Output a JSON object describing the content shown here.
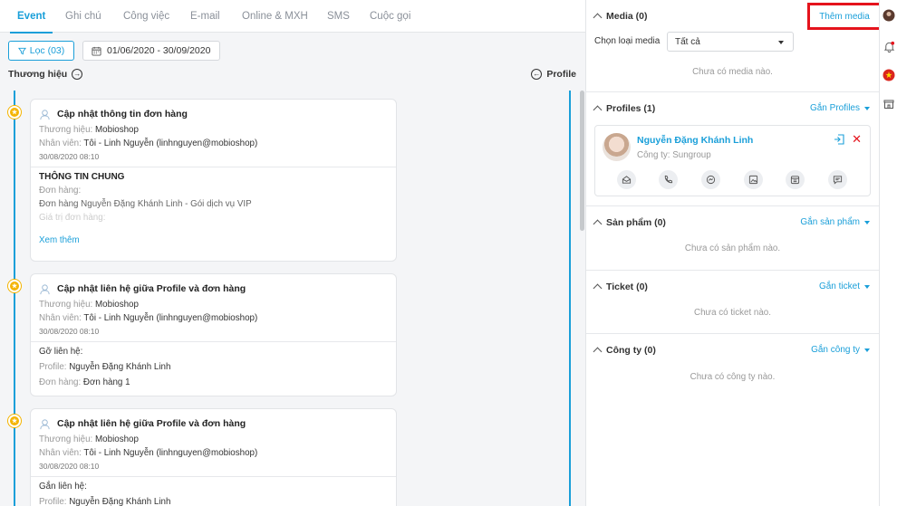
{
  "tabs": [
    "Event",
    "Ghi chú",
    "Công việc",
    "E-mail",
    "Online & MXH",
    "SMS",
    "Cuộc gọi"
  ],
  "filter": {
    "label": "Lọc (03)",
    "date_range": "01/06/2020 - 30/09/2020"
  },
  "headers": {
    "brand": "Thương hiệu",
    "profile": "Profile"
  },
  "events": [
    {
      "title": "Cập nhật thông tin đơn hàng",
      "brand_label": "Thương hiệu:",
      "brand": "Mobioshop",
      "staff_label": "Nhân viên:",
      "staff": "Tôi - Linh Nguyễn (linhnguyen@mobioshop)",
      "time": "30/08/2020 08:10",
      "section_title": "THÔNG TIN CHUNG",
      "order_label": "Đơn hàng:",
      "order_value": "Đơn hàng Nguyễn Đặng Khánh Linh - Gói dịch vụ VIP",
      "faded": "Giá trị đơn hàng:",
      "more": "Xem thêm"
    },
    {
      "title": "Cập nhật liên hệ giữa Profile và đơn hàng",
      "brand_label": "Thương hiệu:",
      "brand": "Mobioshop",
      "staff_label": "Nhân viên:",
      "staff": "Tôi - Linh Nguyễn (linhnguyen@mobioshop)",
      "time": "30/08/2020 08:10",
      "action": "Gỡ liên hệ:",
      "profile_label": "Profile:",
      "profile": "Nguyễn Đặng Khánh Linh",
      "order_label": "Đơn hàng:",
      "order": "Đơn hàng 1"
    },
    {
      "title": "Cập nhật liên hệ giữa Profile và đơn hàng",
      "brand_label": "Thương hiệu:",
      "brand": "Mobioshop",
      "staff_label": "Nhân viên:",
      "staff": "Tôi - Linh Nguyễn (linhnguyen@mobioshop)",
      "time": "30/08/2020 08:10",
      "action": "Gắn liên hệ:",
      "profile_label": "Profile:",
      "profile": "Nguyễn Đặng Khánh Linh"
    }
  ],
  "media": {
    "title": "Media (0)",
    "add": "Thêm media",
    "type_label": "Chọn loại media",
    "type_value": "Tất cả",
    "empty": "Chưa có media nào."
  },
  "profiles": {
    "title": "Profiles (1)",
    "action": "Gắn Profiles",
    "name": "Nguyễn Đặng Khánh Linh",
    "company": "Công ty: Sungroup",
    "actions": [
      "email-icon",
      "phone-icon",
      "messenger-icon",
      "image-icon",
      "calendar-icon",
      "comment-icon"
    ]
  },
  "products": {
    "title": "Sản phẩm (0)",
    "action": "Gắn sản phẩm",
    "empty": "Chưa có sản phẩm nào."
  },
  "tickets": {
    "title": "Ticket (0)",
    "action": "Gắn ticket",
    "empty": "Chưa có ticket nào."
  },
  "companies": {
    "title": "Công ty (0)",
    "action": "Gắn công ty",
    "empty": "Chưa có công ty nào."
  },
  "colors": {
    "accent": "#1a9fd9",
    "highlight_border": "#e5131c",
    "event_dot": "#f4b400",
    "timeline": "#1a9fd9"
  }
}
